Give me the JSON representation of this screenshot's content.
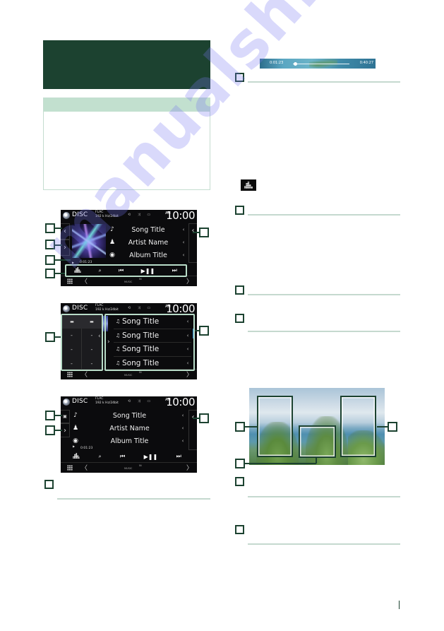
{
  "page": {
    "section_header": "",
    "note_box": {
      "heading": "",
      "body": ""
    },
    "watermark": "manualshive.com",
    "theme": {
      "accent": "#1c4230",
      "note_head": "#c2e0cf",
      "rule": "#c5d9cf"
    }
  },
  "screens": {
    "common": {
      "source": "DISC",
      "format": "FLAC",
      "bitrate": "192 k Hz/24bit",
      "ampm": "AM",
      "clock": "10:00",
      "music_label": "MUSIC",
      "in_label": "IN",
      "nav_left": "〈",
      "nav_right": "〉"
    },
    "play_screen": {
      "song_title": "Song Title",
      "artist_name": "Artist Name",
      "album_title": "Album Title",
      "play_time": "0:01:23",
      "controls": [
        "eq",
        "search",
        "previous",
        "play-pause",
        "next"
      ],
      "control_glyphs": {
        "search": "🔍",
        "previous": "⏮",
        "play_pause": "▶❚❚",
        "next": "⏭"
      },
      "callouts": 5
    },
    "list_screen": {
      "folder_buttons": [
        "folder",
        "folder-up"
      ],
      "empty_cells": [
        "-",
        "-",
        "-",
        "-",
        "-",
        "-"
      ],
      "songs": [
        {
          "title": "Song Title"
        },
        {
          "title": "Song Title"
        },
        {
          "title": "Song Title"
        },
        {
          "title": "Song Title"
        }
      ],
      "callouts": 2
    },
    "compact_screen": {
      "song_title": "Song Title",
      "artist_name": "Artist Name",
      "album_title": "Album Title",
      "play_time": "0:01:23",
      "callouts": 3
    }
  },
  "right_column": {
    "progress": {
      "elapsed": "0:01:23",
      "remaining": "0:40:27",
      "fraction": 0.04
    },
    "items": [
      {
        "label": ""
      },
      {
        "label": ""
      },
      {
        "label": ""
      },
      {
        "label": ""
      },
      {
        "label": ""
      },
      {
        "label": ""
      }
    ],
    "photo_zones": 3
  }
}
